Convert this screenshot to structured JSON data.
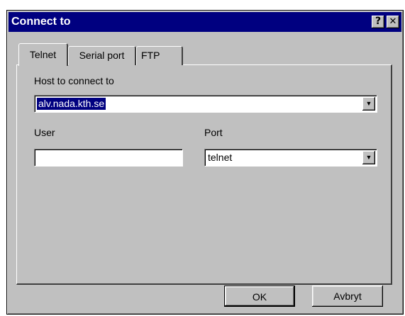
{
  "window": {
    "title": "Connect to",
    "help_glyph": "?",
    "close_glyph": "✕"
  },
  "tabs": [
    {
      "label": "Telnet",
      "active": true
    },
    {
      "label": "Serial port",
      "active": false
    },
    {
      "label": "FTP",
      "active": false
    }
  ],
  "host": {
    "label": "Host to connect to",
    "value": "alv.nada.kth.se"
  },
  "user": {
    "label": "User",
    "value": ""
  },
  "port": {
    "label": "Port",
    "value": "telnet"
  },
  "buttons": {
    "ok": "OK",
    "cancel": "Avbryt"
  },
  "icons": {
    "help": "help-icon",
    "close": "close-icon",
    "dropdown": "chevron-down-icon"
  },
  "colors": {
    "titlebar": "#000080",
    "face": "#c0c0c0",
    "selection": "#000080"
  }
}
